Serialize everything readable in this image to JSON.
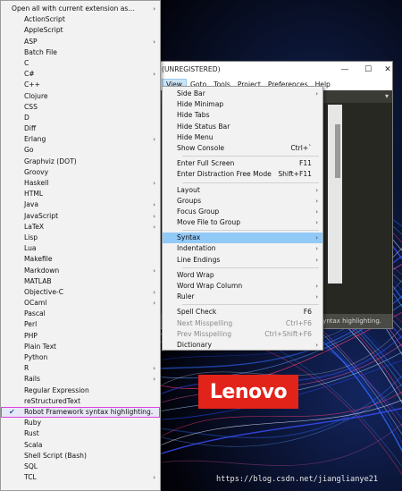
{
  "window": {
    "title": "(UNREGISTERED)",
    "controls": {
      "minimize": "—",
      "maximize": "☐",
      "close": "✕"
    }
  },
  "menubar": [
    "View",
    "Goto",
    "Tools",
    "Project",
    "Preferences",
    "Help"
  ],
  "status_bar": {
    "text": "ork syntax highlighting."
  },
  "syntax_menu": {
    "items": [
      {
        "label": "Open all with current extension as...",
        "arrow": true
      },
      {
        "label": "ActionScript",
        "arrow": false
      },
      {
        "label": "AppleScript",
        "arrow": false
      },
      {
        "label": "ASP",
        "arrow": true
      },
      {
        "label": "Batch File",
        "arrow": false
      },
      {
        "label": "C",
        "arrow": false
      },
      {
        "label": "C#",
        "arrow": true
      },
      {
        "label": "C++",
        "arrow": false
      },
      {
        "label": "Clojure",
        "arrow": false
      },
      {
        "label": "CSS",
        "arrow": false
      },
      {
        "label": "D",
        "arrow": false
      },
      {
        "label": "Diff",
        "arrow": false
      },
      {
        "label": "Erlang",
        "arrow": true
      },
      {
        "label": "Go",
        "arrow": false
      },
      {
        "label": "Graphviz (DOT)",
        "arrow": false
      },
      {
        "label": "Groovy",
        "arrow": false
      },
      {
        "label": "Haskell",
        "arrow": true
      },
      {
        "label": "HTML",
        "arrow": false
      },
      {
        "label": "Java",
        "arrow": true
      },
      {
        "label": "JavaScript",
        "arrow": true
      },
      {
        "label": "LaTeX",
        "arrow": true
      },
      {
        "label": "Lisp",
        "arrow": false
      },
      {
        "label": "Lua",
        "arrow": false
      },
      {
        "label": "Makefile",
        "arrow": false
      },
      {
        "label": "Markdown",
        "arrow": true
      },
      {
        "label": "MATLAB",
        "arrow": false
      },
      {
        "label": "Objective-C",
        "arrow": true
      },
      {
        "label": "OCaml",
        "arrow": true
      },
      {
        "label": "Pascal",
        "arrow": false
      },
      {
        "label": "Perl",
        "arrow": false
      },
      {
        "label": "PHP",
        "arrow": false
      },
      {
        "label": "Plain Text",
        "arrow": false
      },
      {
        "label": "Python",
        "arrow": false
      },
      {
        "label": "R",
        "arrow": true
      },
      {
        "label": "Rails",
        "arrow": true
      },
      {
        "label": "Regular Expression",
        "arrow": false
      },
      {
        "label": "reStructuredText",
        "arrow": false
      },
      {
        "label": "Robot Framework syntax highlighting.",
        "arrow": false,
        "checked": true
      },
      {
        "label": "Ruby",
        "arrow": false
      },
      {
        "label": "Rust",
        "arrow": false
      },
      {
        "label": "Scala",
        "arrow": false
      },
      {
        "label": "Shell Script (Bash)",
        "arrow": false
      },
      {
        "label": "SQL",
        "arrow": false
      },
      {
        "label": "TCL",
        "arrow": true
      }
    ]
  },
  "view_menu": {
    "items": [
      {
        "label": "Side Bar",
        "arrow": true
      },
      {
        "label": "Hide Minimap"
      },
      {
        "label": "Hide Tabs"
      },
      {
        "label": "Hide Status Bar"
      },
      {
        "label": "Hide Menu"
      },
      {
        "label": "Show Console",
        "shortcut": "Ctrl+`"
      },
      {
        "sep": true
      },
      {
        "label": "Enter Full Screen",
        "shortcut": "F11"
      },
      {
        "label": "Enter Distraction Free Mode",
        "shortcut": "Shift+F11"
      },
      {
        "sep": true
      },
      {
        "label": "Layout",
        "arrow": true
      },
      {
        "label": "Groups",
        "arrow": true
      },
      {
        "label": "Focus Group",
        "arrow": true
      },
      {
        "label": "Move File to Group",
        "arrow": true
      },
      {
        "sep": true
      },
      {
        "label": "Syntax",
        "arrow": true,
        "highlight": true
      },
      {
        "label": "Indentation",
        "arrow": true
      },
      {
        "label": "Line Endings",
        "arrow": true
      },
      {
        "sep": true
      },
      {
        "label": "Word Wrap"
      },
      {
        "label": "Word Wrap Column",
        "arrow": true
      },
      {
        "label": "Ruler",
        "arrow": true
      },
      {
        "sep": true
      },
      {
        "label": "Spell Check",
        "shortcut": "F6"
      },
      {
        "label": "Next Misspelling",
        "shortcut": "Ctrl+F6",
        "disabled": true
      },
      {
        "label": "Prev Misspelling",
        "shortcut": "Ctrl+Shift+F6",
        "disabled": true
      },
      {
        "label": "Dictionary",
        "arrow": true
      }
    ]
  },
  "desktop": {
    "logo_text": "Lenovo",
    "logo_color": "#e2231a",
    "watermark": "https://blog.csdn.net/jianglianye21"
  },
  "icons": {
    "submenu_arrow": "›",
    "check": "✔",
    "tab_dropdown": "▾"
  }
}
